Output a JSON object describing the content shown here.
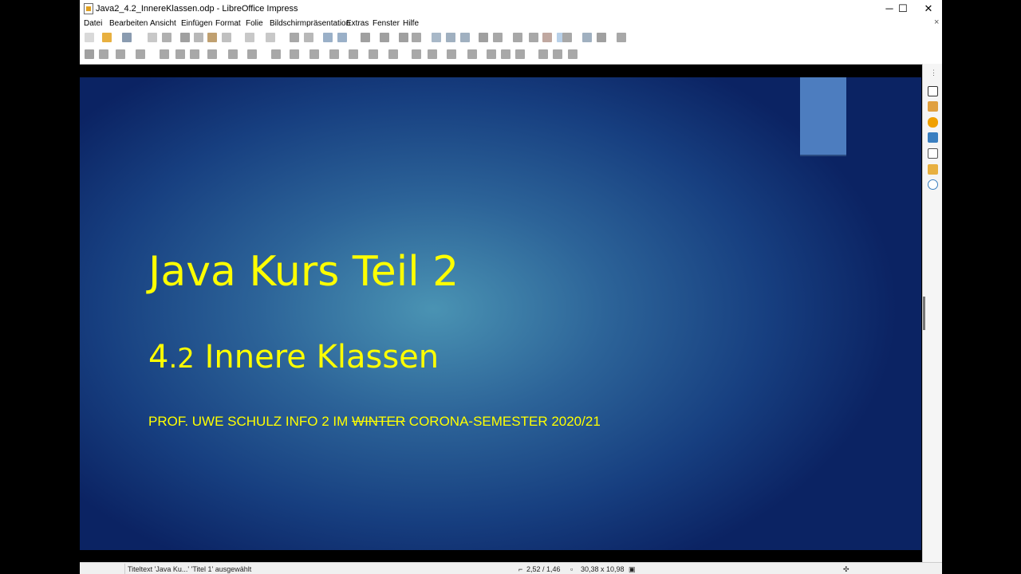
{
  "window": {
    "title": "Java2_4.2_InnereKlassen.odp - LibreOffice Impress",
    "minimize_glyph": "─",
    "maximize_glyph": "☐",
    "close_glyph": "✕",
    "close_doc_glyph": "×"
  },
  "menu": {
    "items": [
      "Datei",
      "Bearbeiten",
      "Ansicht",
      "Einfügen",
      "Format",
      "Folie",
      "Bildschirmpräsentation",
      "Extras",
      "Fenster",
      "Hilfe"
    ]
  },
  "slide": {
    "title": "Java Kurs Teil 2",
    "subtitle_num_a": "4",
    "subtitle_num_b": ".2",
    "subtitle_text": " Innere Klassen",
    "author_pre": "PROF. UWE SCHULZ  INFO 2 IM ",
    "author_strike": "WINTER",
    "author_post": " CORONA-SEMESTER 2020/21",
    "text_color": "#ffff00"
  },
  "statusbar": {
    "selection": "Titeltext 'Java Ku...' 'Titel 1' ausgewählt",
    "position": "2,52 / 1,46",
    "size": "30,38 x 10,98"
  },
  "sidebar": {
    "more_glyph": "⋮",
    "icons": [
      "properties-icon",
      "slide-transition-icon",
      "animation-icon",
      "master-slides-icon",
      "styles-icon",
      "gallery-icon",
      "navigator-icon"
    ]
  }
}
